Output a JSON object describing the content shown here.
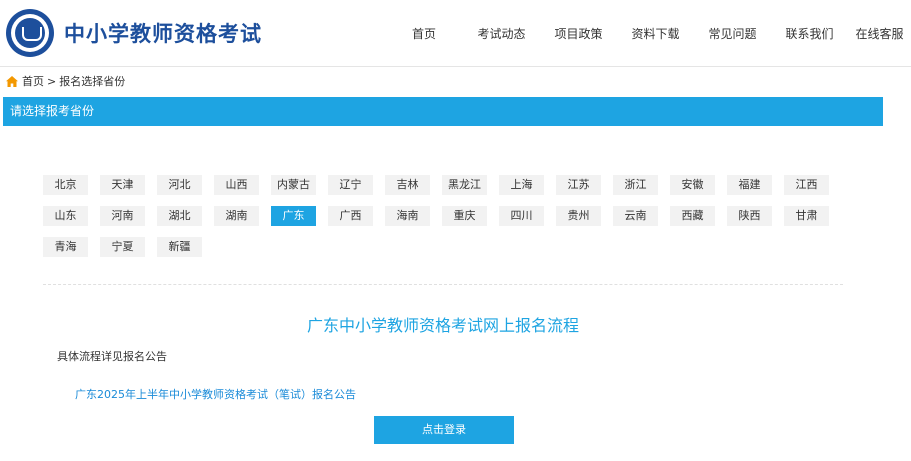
{
  "header": {
    "site_title": "中小学教师资格考试",
    "nav": [
      {
        "label": "首页",
        "active": true
      },
      {
        "label": "考试动态",
        "active": false
      },
      {
        "label": "项目政策",
        "active": false
      },
      {
        "label": "资料下载",
        "active": false
      },
      {
        "label": "常见问题",
        "active": false
      },
      {
        "label": "联系我们",
        "active": false
      },
      {
        "label": "在线客服",
        "active": false
      }
    ]
  },
  "breadcrumb": {
    "home": "首页",
    "separator": ">",
    "current": "报名选择省份"
  },
  "section": {
    "title": "请选择报考省份"
  },
  "provinces": [
    [
      "北京",
      "天津",
      "河北",
      "山西",
      "内蒙古",
      "辽宁",
      "吉林",
      "黑龙江",
      "上海",
      "江苏",
      "浙江",
      "安徽",
      "福建",
      "江西"
    ],
    [
      "山东",
      "河南",
      "湖北",
      "湖南",
      "广东",
      "广西",
      "海南",
      "重庆",
      "四川",
      "贵州",
      "云南",
      "西藏",
      "陕西",
      "甘肃"
    ],
    [
      "青海",
      "宁夏",
      "新疆"
    ]
  ],
  "selected_province": "广东",
  "process": {
    "title": "广东中小学教师资格考试网上报名流程",
    "note": "具体流程详见报名公告",
    "notice_link": "广东2025年上半年中小学教师资格考试（笔试）报名公告",
    "login_button": "点击登录"
  },
  "colors": {
    "accent": "#1ea4e2",
    "brand": "#1d4f9c",
    "link": "#1a8bd8",
    "home_icon": "#f39800"
  }
}
